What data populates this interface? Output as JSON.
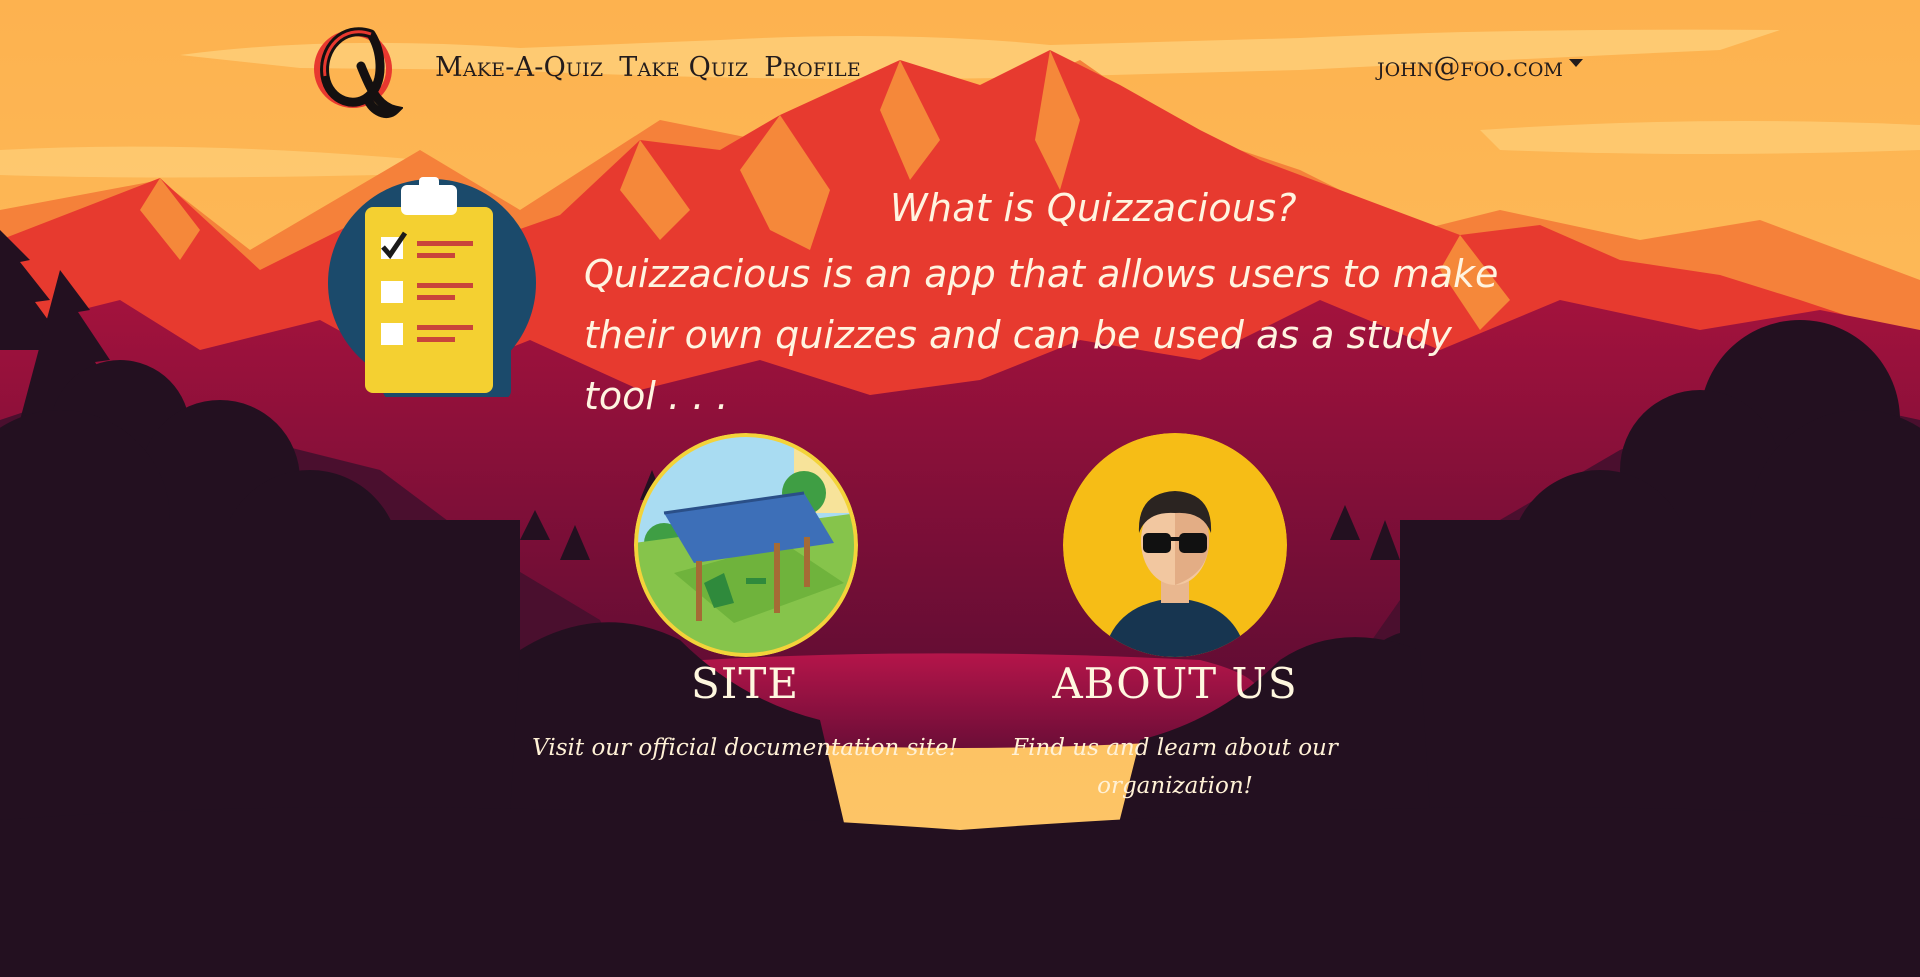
{
  "nav": {
    "logo_alt": "Q",
    "links": [
      {
        "label": "Make-A-Quiz"
      },
      {
        "label": "Take Quiz"
      },
      {
        "label": "Profile"
      }
    ],
    "user_email": "john@foo.com",
    "user_menu_icon": "caret-down-icon"
  },
  "hero": {
    "icon": "clipboard-checklist-icon",
    "title": "What is Quizzacious?",
    "text": "Quizzacious is an app that allows users to make their own quizzes and can be used as a study tool . . ."
  },
  "cards": [
    {
      "image": "solar-pergola-illustration",
      "title": "SITE",
      "description": "Visit our official documentation site!"
    },
    {
      "image": "avatar-sunglasses-illustration",
      "title": "ABOUT US",
      "description": "Find us and learn about our organization!"
    }
  ],
  "colors": {
    "sky": "#fdbd5c",
    "mountain_front": "#e8382f",
    "mountain_highlight": "#f4893a",
    "valley": "#8a0f3b",
    "forest": "#231020",
    "text_light": "#fff4e0",
    "nav_text": "#231c1c"
  }
}
